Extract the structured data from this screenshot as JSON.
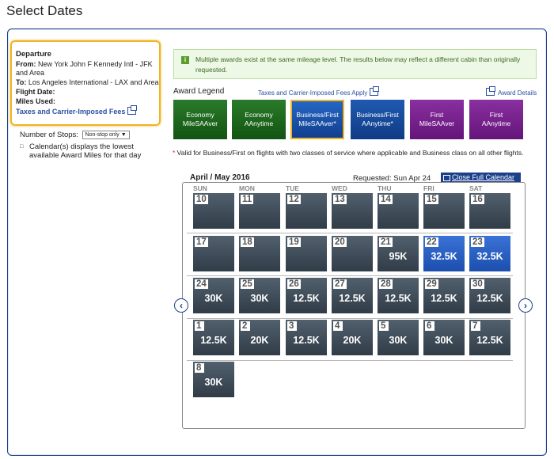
{
  "page": {
    "title": "Select Dates"
  },
  "departure": {
    "heading": "Departure",
    "from_label": "From:",
    "from_value": "New York John F Kennedy Intl - JFK and Area",
    "to_label": "To:",
    "to_value": "Los Angeles International - LAX and Area",
    "flight_date_label": "Flight Date:",
    "miles_used_label": "Miles Used:",
    "taxes_link": "Taxes and Carrier-Imposed Fees"
  },
  "stops": {
    "label": "Number of Stops:",
    "selected": "Non-stop only"
  },
  "calendar_note": "Calendar(s) displays the lowest available Award Miles for that day",
  "alert": {
    "text": "Multiple awards exist at the same mileage level. The results below may reflect a different cabin than originally requested."
  },
  "legend": {
    "label": "Award Legend",
    "taxes_link": "Taxes and Carrier-Imposed Fees Apply",
    "details_link": "Award Details",
    "items": [
      {
        "line1": "Economy",
        "line2": "MileSAAver"
      },
      {
        "line1": "Economy",
        "line2": "AAnytime"
      },
      {
        "line1": "Business/First",
        "line2": "MileSAAver*"
      },
      {
        "line1": "Business/First",
        "line2": "AAnytime*"
      },
      {
        "line1": "First",
        "line2": "MileSAAver"
      },
      {
        "line1": "First",
        "line2": "AAnytime"
      }
    ]
  },
  "footnote": {
    "asterisk": "*",
    "text": " Valid for Business/First on flights with two classes of service where applicable and Business class on all other flights."
  },
  "calendar": {
    "month": "April / May 2016",
    "requested": "Requested: Sun Apr 24",
    "close_label": "Close Full Calendar",
    "prev_icon": "‹",
    "next_icon": "›",
    "weekdays": [
      "SUN",
      "MON",
      "TUE",
      "WED",
      "THU",
      "FRI",
      "SAT"
    ],
    "weeks": [
      [
        {
          "d": "10",
          "p": ""
        },
        {
          "d": "11",
          "p": ""
        },
        {
          "d": "12",
          "p": ""
        },
        {
          "d": "13",
          "p": ""
        },
        {
          "d": "14",
          "p": ""
        },
        {
          "d": "15",
          "p": ""
        },
        {
          "d": "16",
          "p": ""
        }
      ],
      [
        {
          "d": "17",
          "p": ""
        },
        {
          "d": "18",
          "p": ""
        },
        {
          "d": "19",
          "p": ""
        },
        {
          "d": "20",
          "p": ""
        },
        {
          "d": "21",
          "p": "95K"
        },
        {
          "d": "22",
          "p": "32.5K",
          "hl": true
        },
        {
          "d": "23",
          "p": "32.5K",
          "hl": true
        }
      ],
      [
        {
          "d": "24",
          "p": "30K"
        },
        {
          "d": "25",
          "p": "30K"
        },
        {
          "d": "26",
          "p": "12.5K"
        },
        {
          "d": "27",
          "p": "12.5K"
        },
        {
          "d": "28",
          "p": "12.5K"
        },
        {
          "d": "29",
          "p": "12.5K"
        },
        {
          "d": "30",
          "p": "12.5K"
        }
      ],
      [
        {
          "d": "1",
          "p": "12.5K"
        },
        {
          "d": "2",
          "p": "20K"
        },
        {
          "d": "3",
          "p": "12.5K"
        },
        {
          "d": "4",
          "p": "20K"
        },
        {
          "d": "5",
          "p": "30K"
        },
        {
          "d": "6",
          "p": "30K"
        },
        {
          "d": "7",
          "p": "12.5K"
        }
      ],
      [
        {
          "d": "8",
          "p": "30K"
        }
      ]
    ]
  },
  "colors": {
    "accent": "#1c3f8a",
    "highlight": "#f0b323",
    "alert_green": "#eef8e6"
  }
}
